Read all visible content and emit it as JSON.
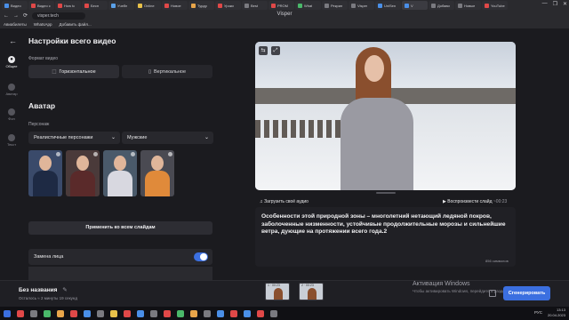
{
  "browser": {
    "tabs": [
      {
        "label": "Видео",
        "color": "#4a8fe8"
      },
      {
        "label": "Видео с",
        "color": "#e04848"
      },
      {
        "label": "How to",
        "color": "#e04848"
      },
      {
        "label": "Бесп",
        "color": "#e04848"
      },
      {
        "label": "Учебн",
        "color": "#5aa0e8"
      },
      {
        "label": "Online",
        "color": "#e8c14a"
      },
      {
        "label": "Новое",
        "color": "#e04848"
      },
      {
        "label": "Турдр",
        "color": "#e8a54a"
      },
      {
        "label": "Уроки",
        "color": "#e04848"
      },
      {
        "label": "Best",
        "color": "#7a7a80"
      },
      {
        "label": "PROM",
        "color": "#e04848"
      },
      {
        "label": "What",
        "color": "#4ab86a"
      },
      {
        "label": "Рекрил",
        "color": "#7a7a80"
      },
      {
        "label": "Visper",
        "color": "#7a7a80"
      },
      {
        "label": "UniSen",
        "color": "#4a8fe8"
      },
      {
        "label": "V",
        "color": "#4a8fe8"
      },
      {
        "label": "Добави",
        "color": "#7a7a80"
      },
      {
        "label": "Новые",
        "color": "#7a7a80"
      },
      {
        "label": "YouTube",
        "color": "#e04848"
      }
    ],
    "page_title": "Visper",
    "url": "visper.tech",
    "window_controls": [
      "—",
      "❐",
      "✕"
    ],
    "bookmarks": [
      "Авиабилеты",
      "WhatsApp",
      "Добавить файл..."
    ]
  },
  "sidebar": {
    "items": [
      {
        "label": "Общее",
        "active": true
      },
      {
        "label": "Аватар",
        "active": false
      },
      {
        "label": "Фон",
        "active": false
      },
      {
        "label": "Текст",
        "active": false
      }
    ]
  },
  "settings": {
    "title": "Настройки всего видео",
    "format_label": "Формат видео",
    "format_horizontal": "Горизонтальное",
    "format_vertical": "Вертикальное",
    "avatar_title": "Аватар",
    "characters_label": "Персонаж",
    "dropdown_style": "Реалистичные персонажи",
    "dropdown_gender": "Мужские",
    "apply_button": "Применить ко всем слайдам",
    "face_swap_label": "Замена лица",
    "face_swap_enabled": true
  },
  "avatars": [
    {
      "bg": "#3a4a6a",
      "suit": "#1e2a44",
      "tie": "#c8a84a"
    },
    {
      "bg": "#4a3a3a",
      "suit": "#5a2a2a",
      "tie": "#7a2a2a"
    },
    {
      "bg": "#4a5a6a",
      "suit": "#d8d8e0",
      "tie": "#d8d8e0"
    },
    {
      "bg": "#4a4a52",
      "suit": "#e08a3a",
      "tie": "#e08a3a"
    }
  ],
  "preview": {
    "upload_audio": "Загрузить своё аудио",
    "play_slide": "Воспроизвести слайд",
    "play_time": "~00:23",
    "script": "Особенности этой природной зоны – многолетний нетающий ледяной покров, заболоченные низменности, устойчивые продолжительные морозы и сильнейшие ветра, дующие на протяжении всего года.2",
    "char_count": "856 символов"
  },
  "footer": {
    "project_name": "Без названия",
    "remaining": "Осталось ≈ 2 минуты 19 секунд",
    "slides": [
      "1 · 00:23",
      "2 · 00:23"
    ],
    "generate_button": "Сгенерировать",
    "activation_title": "Активация Windows",
    "activation_sub": "Чтобы активировать Windows, перейдите в раздел \"Параметры\"."
  },
  "taskbar": {
    "icons": [
      "#3b6fe0",
      "#e04848",
      "#7a7a80",
      "#4ab86a",
      "#e8a54a",
      "#e04848",
      "#4a8fe8",
      "#7a7a80",
      "#e8c14a",
      "#e04848",
      "#4a8fe8",
      "#7a7a80",
      "#e04848",
      "#4ab86a",
      "#e8a54a",
      "#7a7a80",
      "#4a8fe8",
      "#e04848",
      "#4a8fe8",
      "#e04848",
      "#7a7a80"
    ],
    "lang": "РУС",
    "time": "13:13",
    "date": "20.04.2023"
  },
  "colors": {
    "accent": "#3b6fe0",
    "background": "#1b1b1f",
    "panel": "#28282d"
  }
}
